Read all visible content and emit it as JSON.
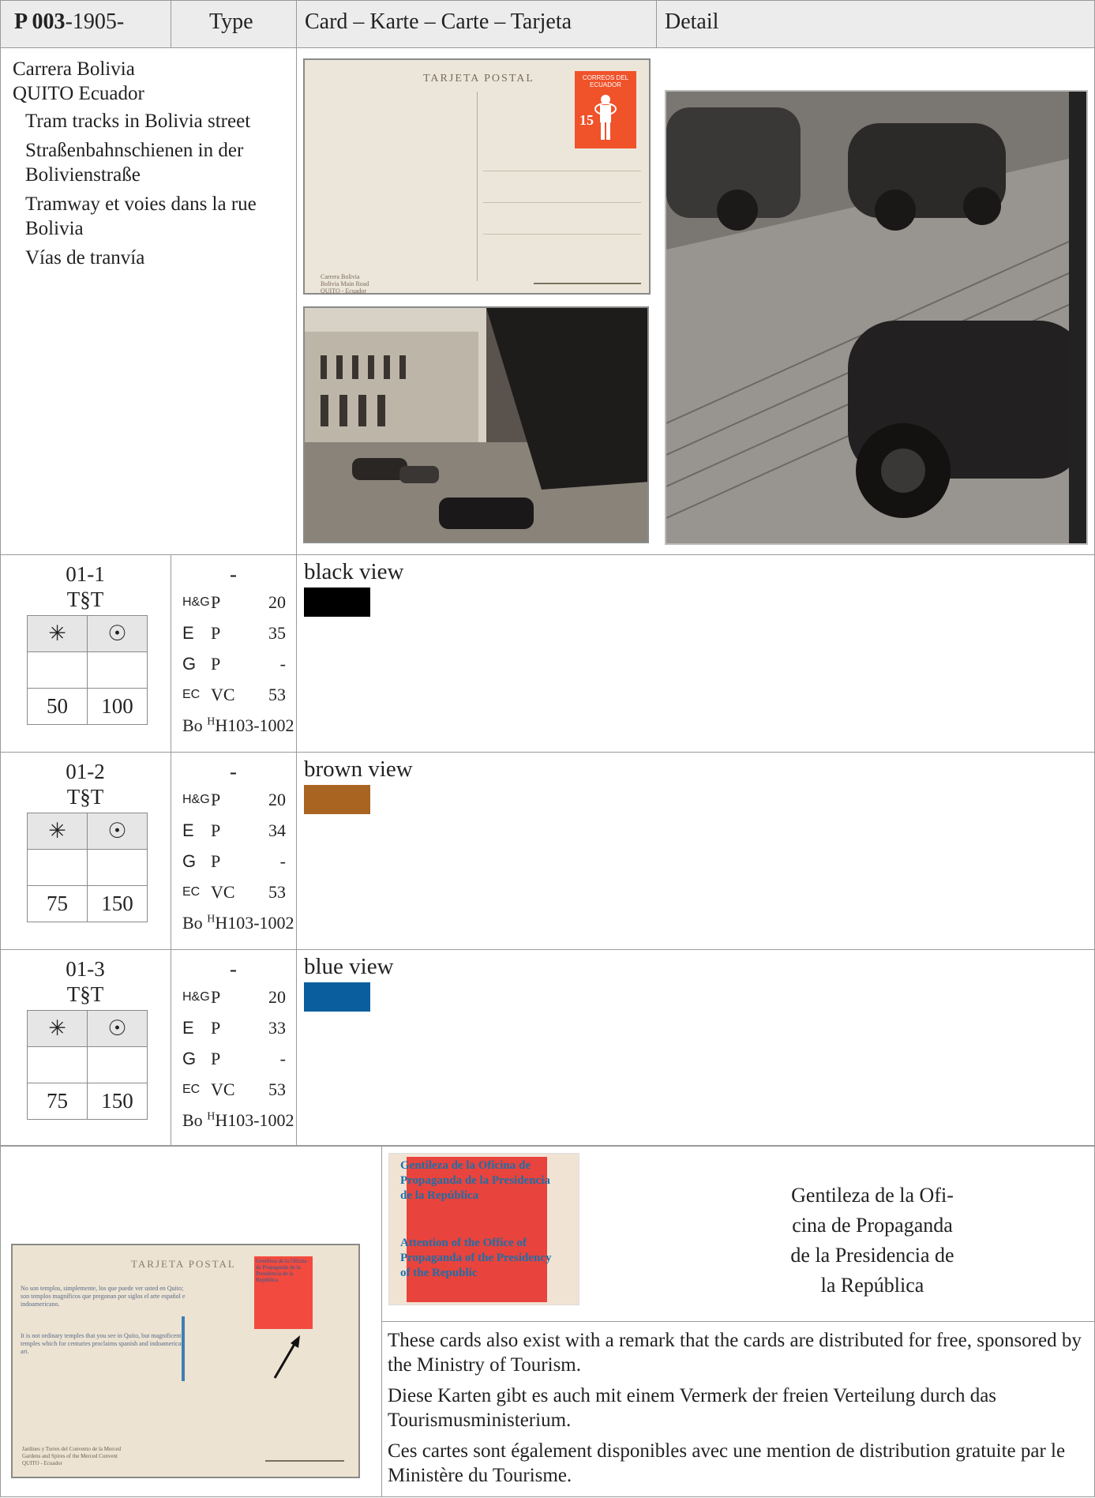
{
  "header": {
    "catalog_code": "P 003",
    "year": "-1905-",
    "col_type": "Type",
    "col_card": "Card – Karte – Carte – Tarjeta",
    "col_detail": "Detail"
  },
  "description": {
    "title_line1": "Carrera Bolivia",
    "title_line2": "QUITO Ecuador",
    "en": "Tram tracks in Bolivia street",
    "de": "Straßenbahnschienen in der Bolivienstraße",
    "fr": "Tramway et voies dans la rue Bolivia",
    "es": "Vías de tranvía"
  },
  "card_front": {
    "heading": "TARJETA POSTAL",
    "stamp_text": "CORREOS DEL ECUADOR",
    "stamp_value": "15",
    "caption": "Carrera Bolivia\nBolivia Main Road\nQUITO - Ecuador"
  },
  "legend": {
    "mint_symbol": "✳",
    "used_symbol": "☉",
    "printer": "T§T"
  },
  "variants": [
    {
      "id": "01-1",
      "printer": "T§T",
      "type": "-",
      "mint_price": "50",
      "used_price": "100",
      "refs": [
        {
          "a": "H&G",
          "b": "P",
          "v": "20"
        },
        {
          "a": "E",
          "b": "P",
          "v": "35"
        },
        {
          "a": "G",
          "b": "P",
          "v": "-"
        },
        {
          "a": "EC",
          "b": "VC",
          "v": "53"
        },
        {
          "a": "Bo",
          "b": "H103-1002",
          "v": ""
        }
      ],
      "color_label": "black view",
      "color": "#000000"
    },
    {
      "id": "01-2",
      "printer": "T§T",
      "type": "-",
      "mint_price": "75",
      "used_price": "150",
      "refs": [
        {
          "a": "H&G",
          "b": "P",
          "v": "20"
        },
        {
          "a": "E",
          "b": "P",
          "v": "34"
        },
        {
          "a": "G",
          "b": "P",
          "v": "-"
        },
        {
          "a": "EC",
          "b": "VC",
          "v": "53"
        },
        {
          "a": "Bo",
          "b": "H103-1002",
          "v": ""
        }
      ],
      "color_label": "brown view",
      "color": "#A86420"
    },
    {
      "id": "01-3",
      "printer": "T§T",
      "type": "-",
      "mint_price": "75",
      "used_price": "150",
      "refs": [
        {
          "a": "H&G",
          "b": "P",
          "v": "20"
        },
        {
          "a": "E",
          "b": "P",
          "v": "33"
        },
        {
          "a": "G",
          "b": "P",
          "v": "-"
        },
        {
          "a": "EC",
          "b": "VC",
          "v": "53"
        },
        {
          "a": "Bo",
          "b": "H103-1002",
          "v": ""
        }
      ],
      "color_label": "blue view",
      "color": "#0A5E9E"
    }
  ],
  "footer": {
    "overprint_es": "Gentileza de la Oficina de Propaganda de la Presidencia de la República",
    "overprint_en": "Attention of the Office of Propaganda of the Presidency of the Republic",
    "gentileza_line1": "Gentileza de la Ofi-",
    "gentileza_line2": "cina de Propaganda",
    "gentileza_line3": "de la Presidencia de",
    "gentileza_line4": "la República",
    "note_en": "These cards also exist with a remark that the cards are distributed for free, sponsored by the Ministry of Tourism.",
    "note_de": "Diese Karten gibt es auch mit einem Vermerk der freien Verteilung durch das Tourismusministerium.",
    "note_fr": "Ces cartes sont également disponibles avec une mention de distribution gratuite par le Ministère du Tourisme.",
    "back_heading": "TARJETA POSTAL",
    "back_text_es": "No son templos, simplemente, los que puede ver usted en Quito; son templos magníficos que pregonan por siglos el arte español e indoamericano.",
    "back_text_en": "It is not ordinary temples that you see in Quito, but magnificent temples which for centuries proclaims spanish and indoamerican art.",
    "back_caption": "Jardines y Torres del Convento de la Merced\nGardens and Spires of the Merced Convent\nQUITO - Ecuador"
  },
  "colors": {
    "header_bg": "#ececec",
    "grid_line": "#9a9a9a",
    "stamp_red": "#F0522A"
  }
}
